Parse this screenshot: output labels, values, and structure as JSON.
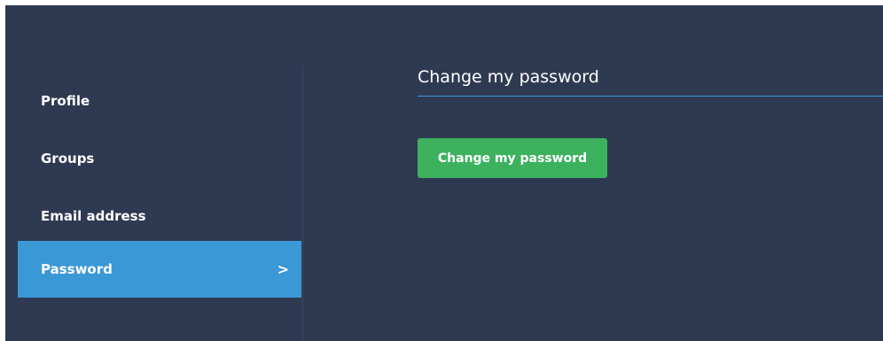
{
  "sidebar": {
    "items": [
      {
        "label": "Profile"
      },
      {
        "label": "Groups"
      },
      {
        "label": "Email address"
      },
      {
        "label": "Password",
        "chevron": ">"
      }
    ]
  },
  "main": {
    "title": "Change my password",
    "button_label": "Change my password"
  },
  "colors": {
    "background": "#2e3a52",
    "active_item": "#3a98d6",
    "button": "#3cb25f",
    "underline": "#3a98d6"
  }
}
